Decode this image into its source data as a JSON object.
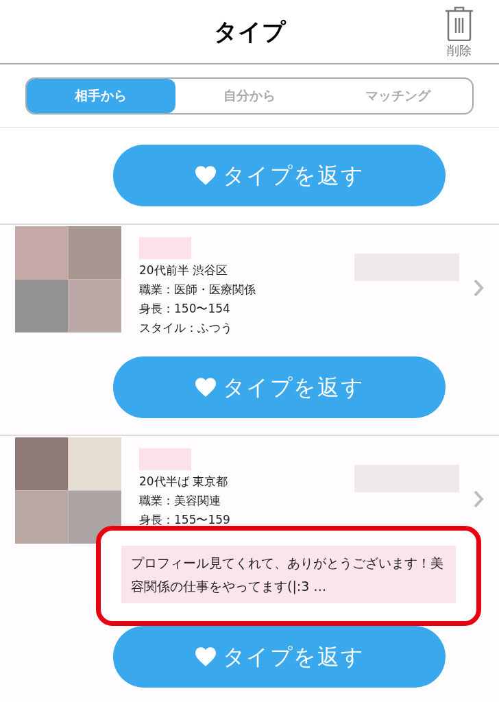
{
  "header": {
    "title": "タイプ",
    "delete_label": "削除"
  },
  "tabs": [
    {
      "label": "相手から",
      "selected": true
    },
    {
      "label": "自分から",
      "selected": false
    },
    {
      "label": "マッチング",
      "selected": false
    }
  ],
  "top_button": {
    "label": "タイプを返す"
  },
  "cards": [
    {
      "lines": [
        "20代前半  渋谷区",
        "職業：医師・医療関係",
        "身長：150〜154",
        "スタイル：ふつう"
      ],
      "button": "タイプを返す"
    },
    {
      "lines": [
        "20代半ば  東京都",
        "職業：美容関連",
        "身長：155〜159"
      ],
      "message": "プロフィール見てくれて、ありがとうございます！美容関係の仕事をやってます(|:3 …",
      "button": "タイプを返す"
    }
  ]
}
